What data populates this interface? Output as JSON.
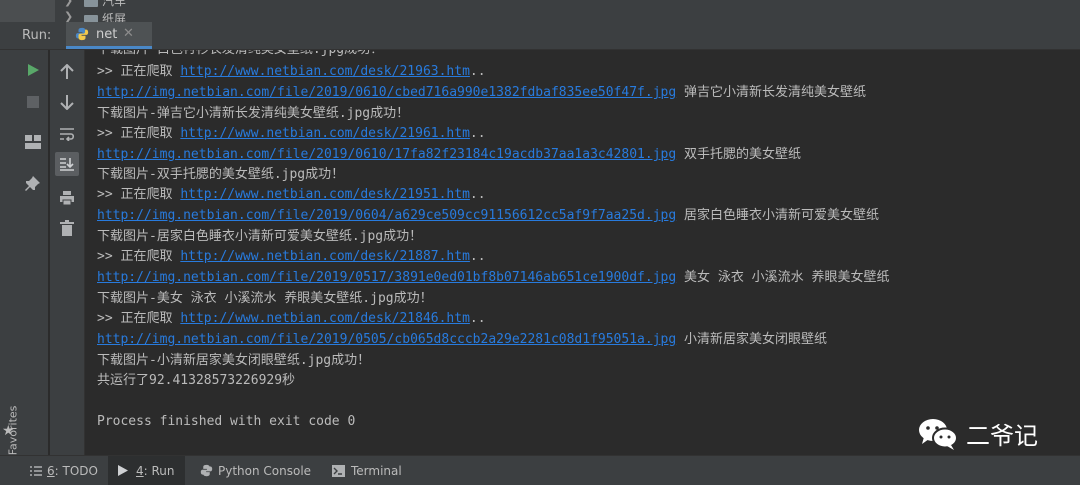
{
  "project_tree": {
    "items": [
      "汽车",
      "纸屏"
    ]
  },
  "run_header": {
    "label": "Run:",
    "tab_name": "net"
  },
  "left_stripe": {
    "favorites_label": "2: Favorites"
  },
  "console": {
    "lines": [
      {
        "text": "下载图片-白色衬衫长发清纯美女壁纸.jpg成功！"
      },
      {
        "prefix": ">> 正在爬取 ",
        "link": "http://www.netbian.com/desk/21963.htm",
        "suffix": ".."
      },
      {
        "link": "http://img.netbian.com/file/2019/0610/cbed716a990e1382fdbaf835ee50f47f.jpg",
        "suffix": " 弹吉它小清新长发清纯美女壁纸"
      },
      {
        "text": "下载图片-弹吉它小清新长发清纯美女壁纸.jpg成功！"
      },
      {
        "prefix": ">> 正在爬取 ",
        "link": "http://www.netbian.com/desk/21961.htm",
        "suffix": ".."
      },
      {
        "link": "http://img.netbian.com/file/2019/0610/17fa82f23184c19acdb37aa1a3c42801.jpg",
        "suffix": " 双手托腮的美女壁纸"
      },
      {
        "text": "下载图片-双手托腮的美女壁纸.jpg成功！"
      },
      {
        "prefix": ">> 正在爬取 ",
        "link": "http://www.netbian.com/desk/21951.htm",
        "suffix": ".."
      },
      {
        "link": "http://img.netbian.com/file/2019/0604/a629ce509cc91156612cc5af9f7aa25d.jpg",
        "suffix": " 居家白色睡衣小清新可爱美女壁纸"
      },
      {
        "text": "下载图片-居家白色睡衣小清新可爱美女壁纸.jpg成功！"
      },
      {
        "prefix": ">> 正在爬取 ",
        "link": "http://www.netbian.com/desk/21887.htm",
        "suffix": ".."
      },
      {
        "link": "http://img.netbian.com/file/2019/0517/3891e0ed01bf8b07146ab651ce1900df.jpg",
        "suffix": " 美女 泳衣 小溪流水 养眼美女壁纸"
      },
      {
        "text": "下载图片-美女 泳衣 小溪流水 养眼美女壁纸.jpg成功！"
      },
      {
        "prefix": ">> 正在爬取 ",
        "link": "http://www.netbian.com/desk/21846.htm",
        "suffix": ".."
      },
      {
        "link": "http://img.netbian.com/file/2019/0505/cb065d8cccb2a29e2281c08d1f95051a.jpg",
        "suffix": " 小清新居家美女闭眼壁纸"
      },
      {
        "text": "下载图片-小清新居家美女闭眼壁纸.jpg成功！"
      },
      {
        "text": "共运行了92.41328573226929秒"
      },
      {
        "text": ""
      },
      {
        "text": "Process finished with exit code 0"
      }
    ]
  },
  "watermark": {
    "text": "二爷记"
  },
  "bottom_bar": {
    "todo_number": "6",
    "todo_label": ": TODO",
    "run_number": "4",
    "run_label": ": Run",
    "python_console_label": "Python Console",
    "terminal_label": "Terminal"
  },
  "colors": {
    "link": "#287bde",
    "text": "#bbbbbb",
    "background": "#2b2b2b",
    "panel": "#3c3f41",
    "run_green": "#59a869"
  }
}
